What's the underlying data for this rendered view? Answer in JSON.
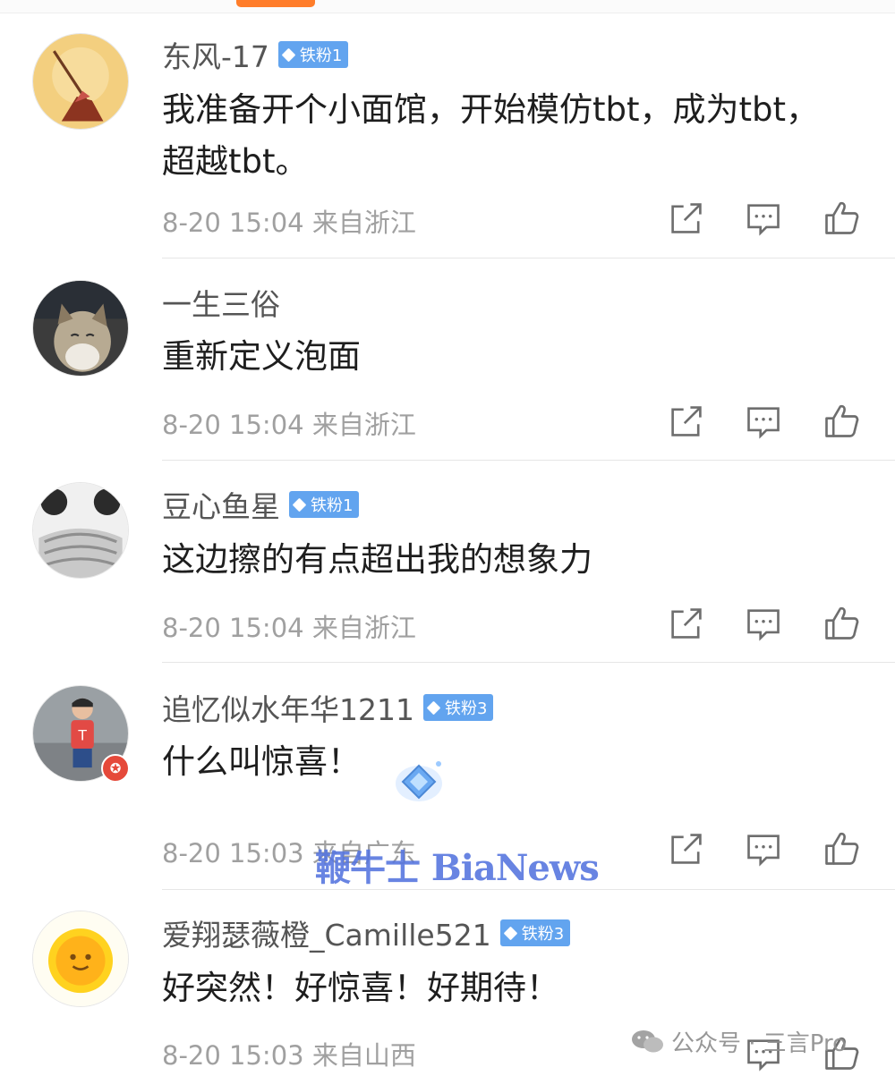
{
  "comments": [
    {
      "username": "东风-17",
      "badge": "铁粉1",
      "text": "我准备开个小面馆，开始模仿tbt，成为tbt，超越tbt。",
      "time": "8-20 15:04",
      "location": "来自浙江"
    },
    {
      "username": "一生三俗",
      "badge": "",
      "text": "重新定义泡面",
      "time": "8-20 15:04",
      "location": "来自浙江"
    },
    {
      "username": "豆心鱼星",
      "badge": "铁粉1",
      "text": "这边擦的有点超出我的想象力",
      "time": "8-20 15:04",
      "location": "来自浙江"
    },
    {
      "username": "追忆似水年华1211",
      "badge": "铁粉3",
      "text": "什么叫惊喜！",
      "time": "8-20 15:03",
      "location": "来自广东"
    },
    {
      "username": "爱翔瑟薇橙_Camille521",
      "badge": "铁粉3",
      "text": "好突然！好惊喜！好期待！",
      "time": "8-20 15:03",
      "location": "来自山西"
    }
  ],
  "watermark": "鞭牛士 BiaNews",
  "wechat_watermark": "公众号 · 三言Pro",
  "colors": {
    "accent": "#ff7d2a",
    "fan_badge": "#62a4ef",
    "vip": "#e5493a"
  },
  "icons": {
    "share": "share-icon",
    "comment": "comment-icon",
    "like": "like-icon",
    "fan_badge": "diamond-icon"
  }
}
